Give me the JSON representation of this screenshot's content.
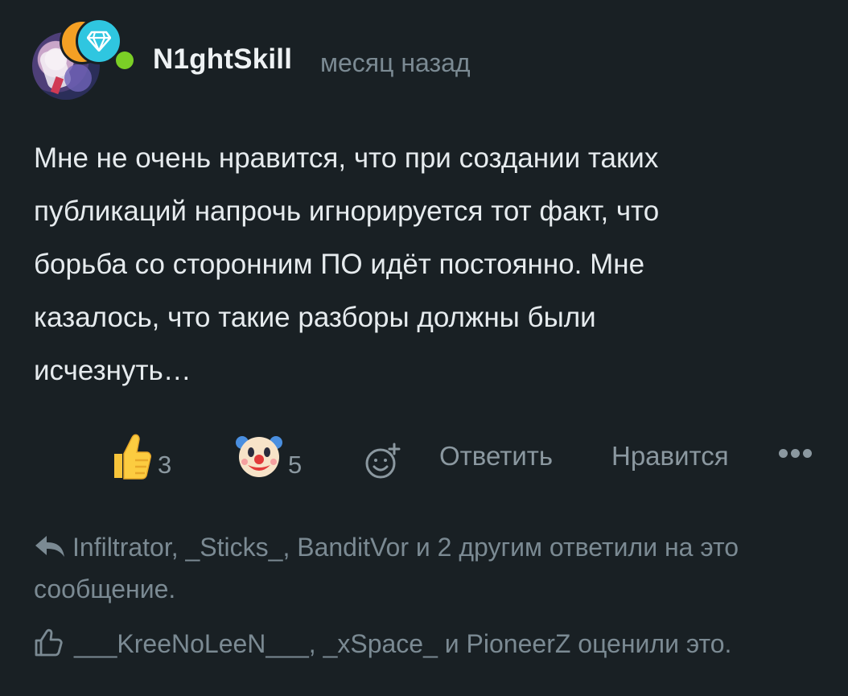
{
  "comment": {
    "author": "N1ghtSkill",
    "time": "месяц назад",
    "text": "Мне не очень нравится, что при создании таких публикаций напрочь игнорируется тот факт, что борьба со сторонним ПО идёт постоянно. Мне казалось, что такие разборы должны были исчезнуть…"
  },
  "reactions": [
    {
      "icon": "thumbs-up-emoji",
      "count": "3"
    },
    {
      "icon": "clown-face-emoji",
      "count": "5"
    }
  ],
  "actions": {
    "reply_label": "Ответить",
    "like_label": "Нравится"
  },
  "replies_summary": "Infiltrator, _Sticks_, BanditVor и 2 другим ответили на это сообщение.",
  "likers_summary": "___KreeNoLeeN___, _xSpace_ и PioneerZ оценили это.",
  "colors": {
    "background": "#192024",
    "online": "#7bcf26",
    "muted": "#7b8a93",
    "badge_orange": "#f4a024",
    "badge_cyan": "#2fc6e0"
  }
}
